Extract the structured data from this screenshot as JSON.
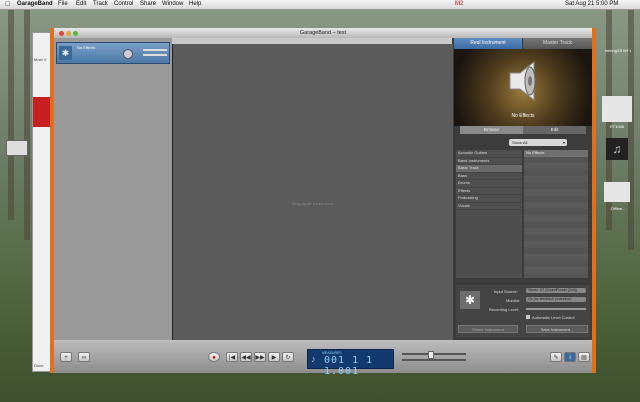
{
  "menubar": {
    "app_name": "GarageBand",
    "items": [
      "File",
      "Edit",
      "Track",
      "Control",
      "Share",
      "Window",
      "Help"
    ],
    "status_m2": "M2",
    "clock": "Sat Aug 21 5:00 PM"
  },
  "background_window": {
    "label_1": "Most V",
    "label_2": "Done"
  },
  "desktop_icons": [
    "eeinngl15 M+1",
    "ET1046",
    "Offline...",
    "..."
  ],
  "window": {
    "title": "GarageBand – test",
    "track": {
      "name": "No Effects"
    },
    "drop_hint": "Drag Apple Loops here.",
    "tabs": {
      "real": "Real Instrument",
      "master": "Master Track"
    },
    "instrument_label": "No Effects",
    "subtabs": {
      "browse": "Browse",
      "edit": "Edit"
    },
    "show_all": "Show All",
    "categories": [
      "Acoustic Guitars",
      "Band Instruments",
      "Basic Track",
      "Bass",
      "Drums",
      "Effects",
      "Podcasting",
      "Vocals"
    ],
    "selected_category": "Basic Track",
    "effects": [
      "No Effects"
    ],
    "input_source_label": "Input Source:",
    "input_source_value": "Stereo 1/2 (SoundFlower (2ch))",
    "monitor_label": "Monitor:",
    "monitor_value": "On (no feedback protection)",
    "recording_level_label": "Recording Level:",
    "auto_level": "Automatic Level Control",
    "delete_btn": "Delete Instrument",
    "save_btn": "Save Instrument..."
  },
  "transport": {
    "lcd_top": "MEASURES",
    "lcd_value": "001 1 1 1.001"
  }
}
